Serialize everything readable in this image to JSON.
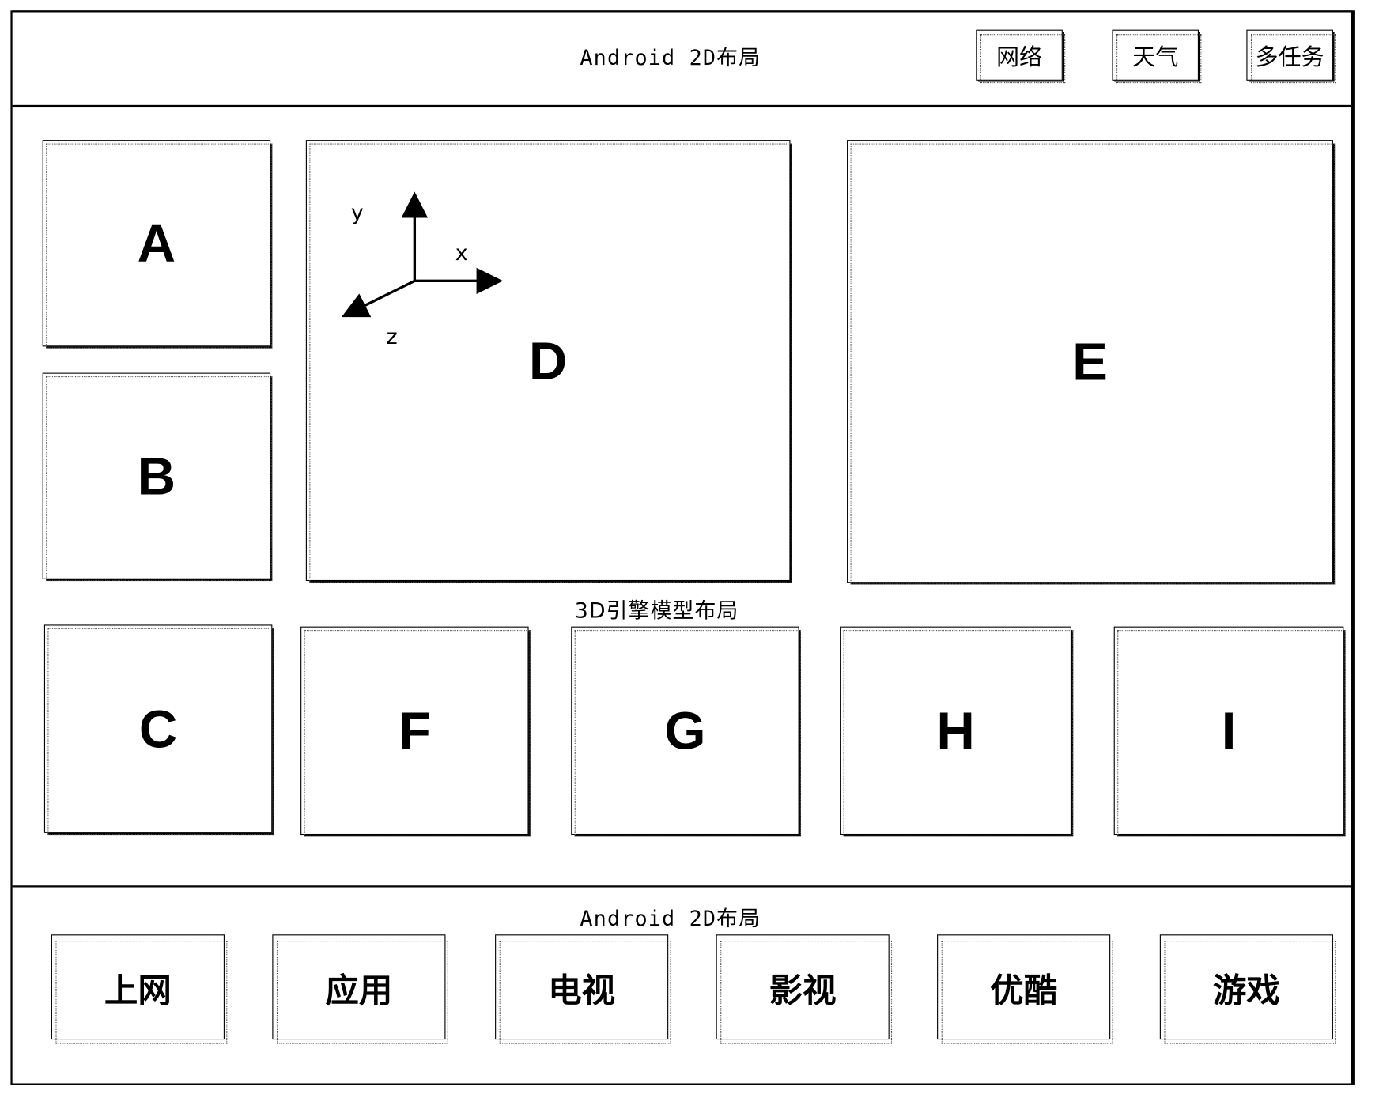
{
  "header": {
    "title": "Android 2D布局",
    "buttons": [
      {
        "label": "网络"
      },
      {
        "label": "天气"
      },
      {
        "label": "多任务"
      }
    ]
  },
  "engine_area": {
    "caption": "3D引擎模型布局",
    "boxes": {
      "A": "A",
      "B": "B",
      "C": "C",
      "D": "D",
      "E": "E",
      "F": "F",
      "G": "G",
      "H": "H",
      "I": "I"
    },
    "axes": {
      "x": "x",
      "y": "y",
      "z": "z"
    }
  },
  "footer": {
    "title": "Android 2D布局",
    "buttons": [
      {
        "label": "上网"
      },
      {
        "label": "应用"
      },
      {
        "label": "电视"
      },
      {
        "label": "影视"
      },
      {
        "label": "优酷"
      },
      {
        "label": "游戏"
      }
    ]
  }
}
